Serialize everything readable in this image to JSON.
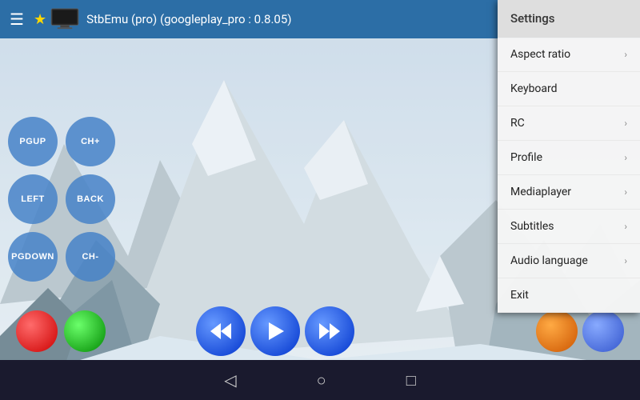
{
  "app": {
    "title": "StbEmu (pro) (googleplay_pro : 0.8.05)"
  },
  "topbar": {
    "hamburger": "☰",
    "star": "★"
  },
  "controls": {
    "rows": [
      [
        "PGUP",
        "CH+"
      ],
      [
        "LEFT",
        "BACK"
      ],
      [
        "PGDOWN",
        "CH-"
      ]
    ]
  },
  "transport": {
    "rewind": "⏪",
    "play": "▶",
    "forward": "⏩"
  },
  "navbar": {
    "back": "◁",
    "home": "○",
    "square": "□"
  },
  "menu": {
    "header": "Settings",
    "items": [
      {
        "label": "Aspect ratio",
        "hasArrow": true
      },
      {
        "label": "Keyboard",
        "hasArrow": false
      },
      {
        "label": "RC",
        "hasArrow": true
      },
      {
        "label": "Profile",
        "hasArrow": true
      },
      {
        "label": "Mediaplayer",
        "hasArrow": true
      },
      {
        "label": "Subtitles",
        "hasArrow": true
      },
      {
        "label": "Audio language",
        "hasArrow": true
      },
      {
        "label": "Exit",
        "hasArrow": false
      }
    ]
  },
  "colors": {
    "topbar": "#2a7ab8",
    "menu_bg": "#f0f0f0"
  }
}
